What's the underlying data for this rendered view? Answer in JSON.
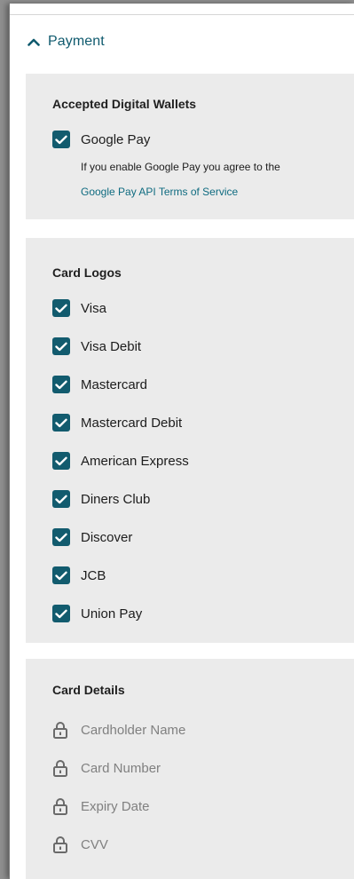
{
  "payment": {
    "title": "Payment",
    "wallets": {
      "title": "Accepted Digital Wallets",
      "items": [
        {
          "label": "Google Pay",
          "checked": true
        }
      ],
      "note": "If you enable Google Pay you agree to the",
      "link": "Google Pay API Terms of Service"
    },
    "card_logos": {
      "title": "Card Logos",
      "items": [
        {
          "label": "Visa",
          "checked": true
        },
        {
          "label": "Visa Debit",
          "checked": true
        },
        {
          "label": "Mastercard",
          "checked": true
        },
        {
          "label": "Mastercard Debit",
          "checked": true
        },
        {
          "label": "American Express",
          "checked": true
        },
        {
          "label": "Diners Club",
          "checked": true
        },
        {
          "label": "Discover",
          "checked": true
        },
        {
          "label": "JCB",
          "checked": true
        },
        {
          "label": "Union Pay",
          "checked": true
        }
      ]
    },
    "card_details": {
      "title": "Card Details",
      "items": [
        {
          "label": "Cardholder Name",
          "icon": "lock-icon"
        },
        {
          "label": "Card Number",
          "icon": "lock-icon"
        },
        {
          "label": "Expiry Date",
          "icon": "lock-icon"
        },
        {
          "label": "CVV",
          "icon": "lock-icon"
        }
      ]
    }
  },
  "colors": {
    "accent": "#125b6e",
    "link": "#0f6b80",
    "section_bg": "#ebebeb",
    "muted": "#808080"
  }
}
